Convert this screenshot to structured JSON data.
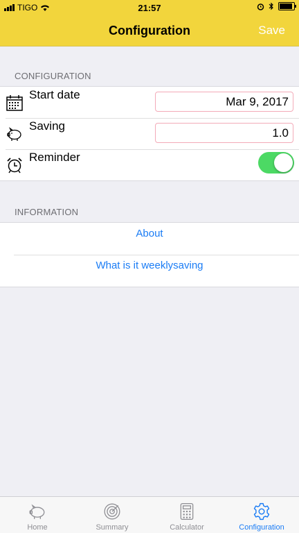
{
  "status_bar": {
    "carrier": "TIGO",
    "time": "21:57",
    "battery_level": 0.9
  },
  "nav": {
    "title": "Configuration",
    "save_label": "Save"
  },
  "configuration": {
    "header": "CONFIGURATION",
    "start_date": {
      "label": "Start date",
      "value": "Mar 9, 2017"
    },
    "saving": {
      "label": "Saving",
      "value": "1.0"
    },
    "reminder": {
      "label": "Reminder",
      "enabled": true
    }
  },
  "information": {
    "header": "INFORMATION",
    "links": [
      "About",
      "What is it weeklysaving"
    ]
  },
  "tabs": [
    {
      "label": "Home",
      "icon": "piggy-bank-icon",
      "active": false
    },
    {
      "label": "Summary",
      "icon": "target-icon",
      "active": false
    },
    {
      "label": "Calculator",
      "icon": "calculator-icon",
      "active": false
    },
    {
      "label": "Configuration",
      "icon": "gear-icon",
      "active": true
    }
  ],
  "colors": {
    "accent": "#f2d53c",
    "link": "#1a7cf5",
    "toggle_on": "#4cd964",
    "field_border": "#f3aab8"
  }
}
